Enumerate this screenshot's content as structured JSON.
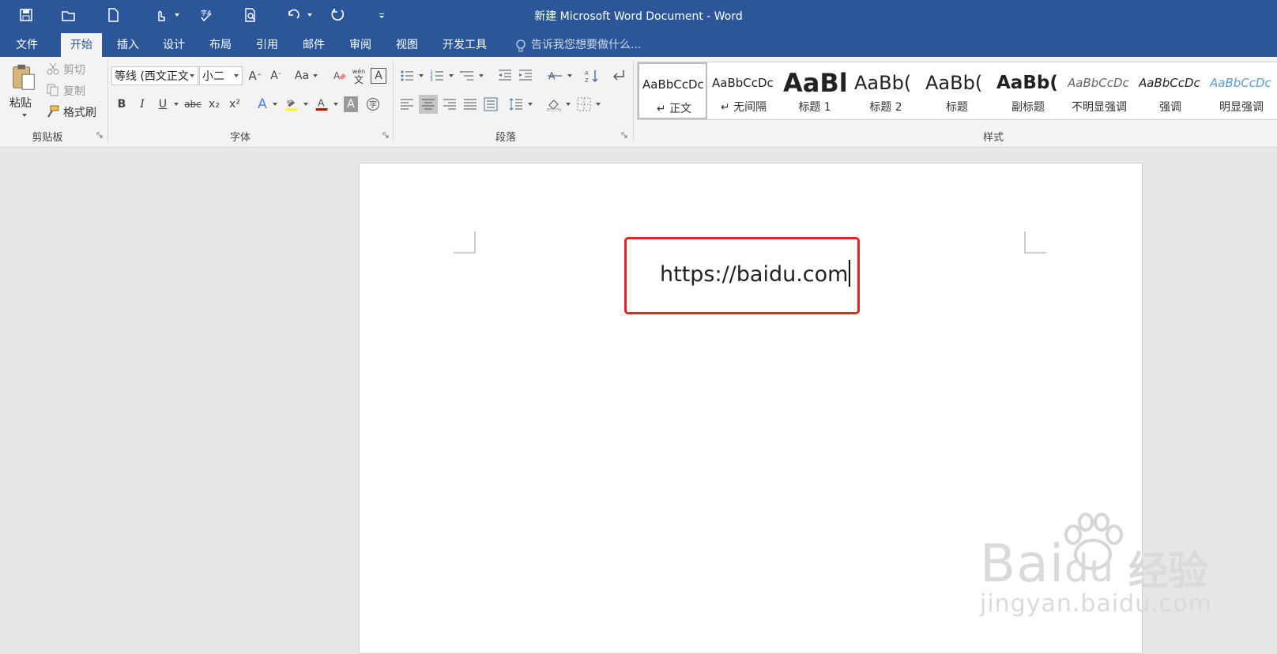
{
  "window": {
    "title": "新建 Microsoft Word Document - Word"
  },
  "tabs": [
    "文件",
    "开始",
    "插入",
    "设计",
    "布局",
    "引用",
    "邮件",
    "审阅",
    "视图",
    "开发工具"
  ],
  "active_tab": "开始",
  "tell_me": "告诉我您想要做什么...",
  "clipboard": {
    "paste": "粘贴",
    "cut": "剪切",
    "copy": "复制",
    "format_painter": "格式刷",
    "group_label": "剪贴板"
  },
  "font": {
    "name": "等线 (西文正文",
    "size": "小二",
    "group_label": "字体",
    "change_case": "Aa",
    "bold": "B",
    "italic": "I",
    "underline": "U",
    "strike": "abc",
    "sub": "x₂",
    "sup": "x²",
    "pinyin": "wén"
  },
  "paragraph": {
    "group_label": "段落"
  },
  "styles": {
    "group_label": "样式",
    "items": [
      {
        "sample": "AaBbCcDc",
        "name": "↵ 正文"
      },
      {
        "sample": "AaBbCcDc",
        "name": "↵ 无间隔"
      },
      {
        "sample": "AaBl",
        "name": "标题 1"
      },
      {
        "sample": "AaBb(",
        "name": "标题 2"
      },
      {
        "sample": "AaBb(",
        "name": "标题"
      },
      {
        "sample": "AaBb(",
        "name": "副标题"
      },
      {
        "sample": "AaBbCcDc",
        "name": "不明显强调"
      },
      {
        "sample": "AaBbCcDc",
        "name": "强调"
      },
      {
        "sample": "AaBbCcDc",
        "name": "明显强调"
      }
    ]
  },
  "document": {
    "text": "https://baidu.com"
  },
  "watermark": {
    "brand": "Bai",
    "brand2": "du",
    "cn": "经验",
    "url": "jingyan.baidu.com"
  },
  "colors": {
    "accent": "#2b579a",
    "highlight_box": "#e8231e"
  }
}
